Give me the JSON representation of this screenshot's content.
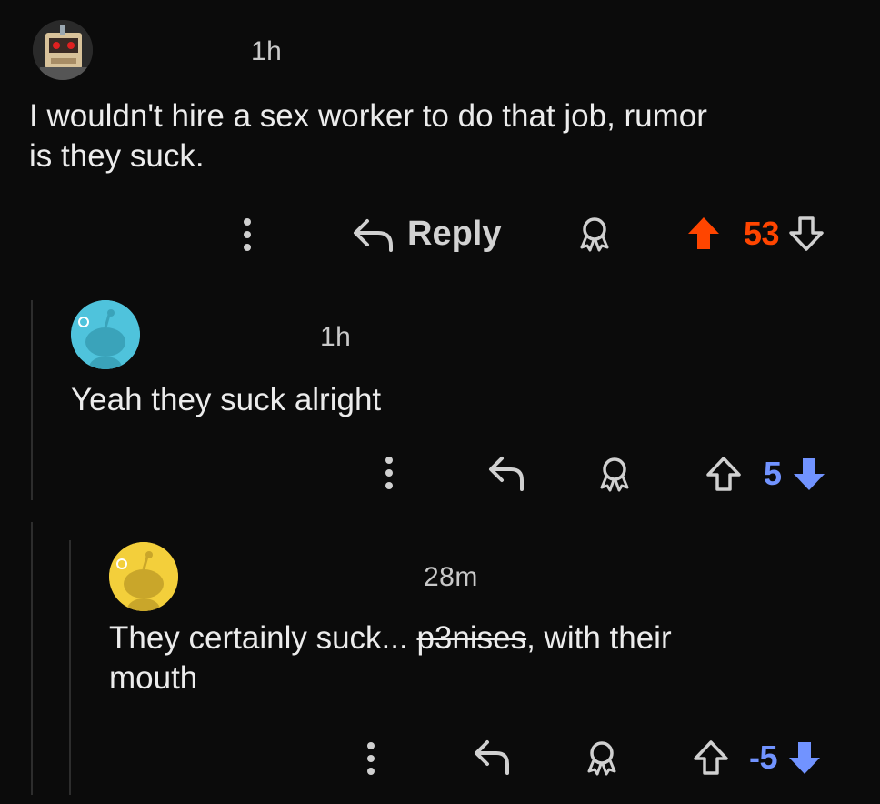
{
  "colors": {
    "upvote_active": "#ff4500",
    "downvote_active": "#7193ff",
    "score_upvoted": "#ff4500",
    "score_downvoted": "#7193ff",
    "icon_default": "#d0d0d0"
  },
  "comments": [
    {
      "timestamp": "1h",
      "text": "I wouldn't hire a sex worker to do that job, rumor is they suck.",
      "text_line1": "I wouldn't hire a sex worker to do that job, rumor",
      "text_line2": "is they suck.",
      "reply_label": "Reply",
      "score": "53",
      "vote_state": "upvoted",
      "avatar_icon": "robot-avatar-icon"
    },
    {
      "timestamp": "1h",
      "text": "Yeah they suck alright",
      "score": "5",
      "vote_state": "downvoted",
      "avatar_icon": "snoo-avatar-icon",
      "avatar_color": "#4fc3dc"
    },
    {
      "timestamp": "28m",
      "text_before": "They certainly suck... ",
      "text_struck": "p3nises",
      "text_after": ", with their",
      "text_line2": "mouth",
      "score": "-5",
      "vote_state": "downvoted",
      "avatar_icon": "snoo-avatar-icon",
      "avatar_color": "#f3cf3b"
    }
  ]
}
